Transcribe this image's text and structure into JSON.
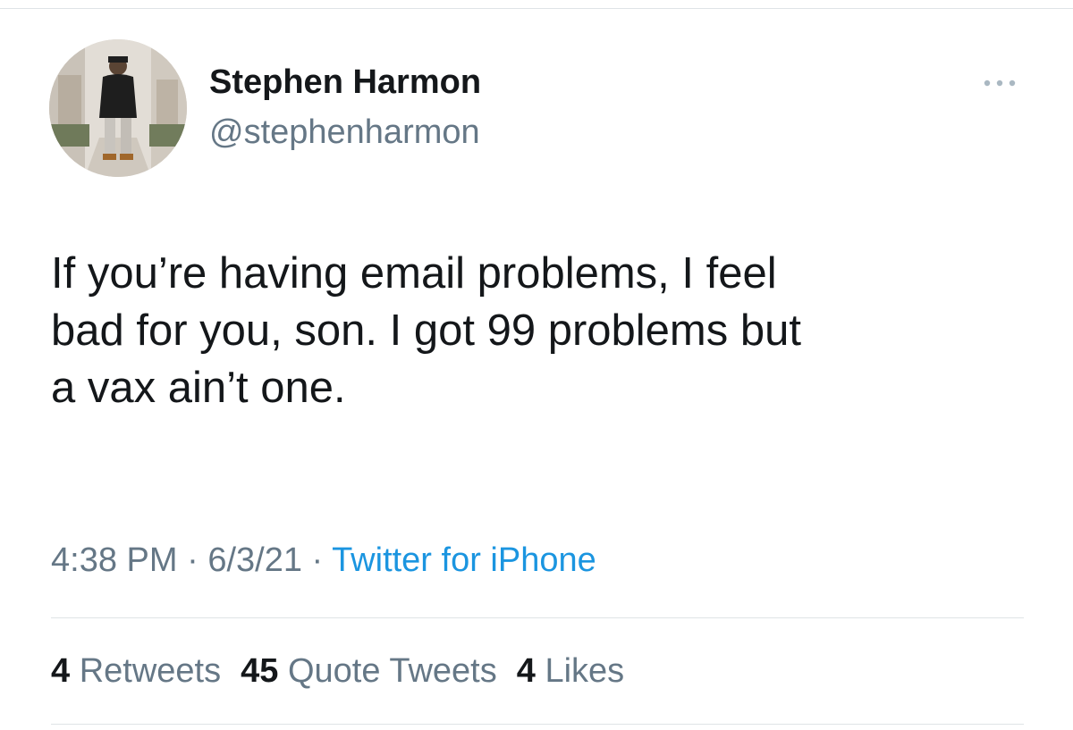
{
  "author": {
    "display_name": "Stephen Harmon",
    "handle": "@stephenharmon",
    "avatar_icon": "profile-photo"
  },
  "tweet": {
    "text": "If you’re having email problems, I feel\nbad for you, son. I got 99 problems but\na vax ain’t one."
  },
  "meta": {
    "time": "4:38 PM",
    "separator": " · ",
    "date": "6/3/21",
    "source": "Twitter for iPhone"
  },
  "stats": {
    "retweets_count": "4",
    "retweets_label": "Retweets",
    "quotes_count": "45",
    "quotes_label": "Quote Tweets",
    "likes_count": "4",
    "likes_label": "Likes"
  },
  "menu": {
    "icon": "more-horizontal-icon"
  },
  "colors": {
    "text_primary": "#14171a",
    "text_secondary": "#657786",
    "link": "#1b95e0",
    "divider": "#dfe3e6"
  }
}
